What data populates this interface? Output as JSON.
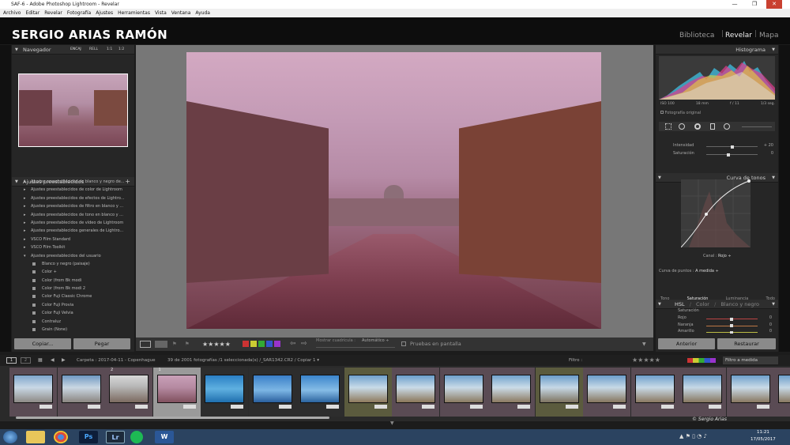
{
  "window": {
    "title": "SAF-6 - Adobe Photoshop Lightroom - Revelar",
    "controls": [
      "—",
      "❐",
      "✕"
    ]
  },
  "menu": [
    "Archivo",
    "Editar",
    "Revelar",
    "Fotografía",
    "Ajustes",
    "Herramientas",
    "Vista",
    "Ventana",
    "Ayuda"
  ],
  "identity": {
    "plate": "SERGIO ARIAS RAMÓN",
    "modules": [
      "Biblioteca",
      "Revelar",
      "Mapa"
    ],
    "active_module": "Revelar"
  },
  "left": {
    "navigator": {
      "title": "Navegador",
      "zoom": [
        "ENCAJ",
        "RELL",
        "1:1",
        "1:2"
      ]
    },
    "presets_title": "Ajustes preestablecidos",
    "presets": [
      "Ajustes preestablecidos de blanco y negro de...",
      "Ajustes preestablecidos de color de Lightroom",
      "Ajustes preestablecidos de efectos de Lightro...",
      "Ajustes preestablecidos de filtro en blanco y ...",
      "Ajustes preestablecidos de tono en blanco y ...",
      "Ajustes preestablecidos de vídeo de Lightroom",
      "Ajustes preestablecidos generales de Lightro...",
      "VSCO Film Standard",
      "VSCO Film Toolkit",
      "Ajustes preestablecidos del usuario"
    ],
    "user_presets": [
      "Blanco y negro (paisaje)",
      "Color +",
      "Color (from Bk modi",
      "Color (from Bk modi 2",
      "Color Fuji Classic Chrome",
      "Color Fuji Provia",
      "Color Fuji Velvia",
      "Contraluz",
      "Grain (None)"
    ],
    "copy_label": "Copiar...",
    "paste_label": "Pegar"
  },
  "right": {
    "histogram_title": "Histograma",
    "exif": [
      "ISO 100",
      "18 mm",
      "f / 11",
      "1/3 seg."
    ],
    "original_label": "Fotografía original",
    "sliders": [
      {
        "label": "Intensidad",
        "value": "+ 20"
      },
      {
        "label": "Saturación",
        "value": "0"
      }
    ],
    "curve_title": "Curva de tonos",
    "curve_channel": "Canal :",
    "curve_channel_value": "Rojo ÷",
    "curve_points_label": "Curva de puntos :",
    "curve_points_value": "A medida ÷",
    "hsl_tabs": [
      "HSL",
      "/",
      "Color",
      "/",
      "Blanco y negro"
    ],
    "hsl_subtabs": [
      "Tono",
      "Saturación",
      "Luminancia",
      "Todo"
    ],
    "hsl_section": "Saturación",
    "hsl_rows": [
      {
        "label": "Rojo",
        "value": "0"
      },
      {
        "label": "Naranja",
        "value": "0"
      },
      {
        "label": "Amarillo",
        "value": "0"
      }
    ],
    "previous_label": "Anterior",
    "reset_label": "Restaurar"
  },
  "toolbar": {
    "stars": "★★★★★",
    "grid_label": "Mostrar cuadrícula :",
    "grid_value": "Automático ÷",
    "softproof_label": "Pruebas en pantalla"
  },
  "filmstrip": {
    "pages": [
      "1",
      "2"
    ],
    "folder": "Carpeta : 2017-04-11 - Copenhague",
    "count": "39 de 2001 fotografías /1 seleccionada(s) /_SAR1342.CR2 / Copiar 1 ▾",
    "filter_label": "Filtro :",
    "filter_value": "Filtro a medida",
    "thumb_labels": [
      "2",
      "1"
    ],
    "thumbs": [
      {
        "bg": "linear-gradient(180deg,#7fa6cc 0%,#c9d8e6 45%,#8d8a85 100%)",
        "frame": "#5a4b54"
      },
      {
        "bg": "linear-gradient(180deg,#6f98c2 0%,#cad7e3 45%,#8a8580 100%)",
        "frame": "#5a4b54"
      },
      {
        "bg": "linear-gradient(180deg,#d7d7d7 0%,#b8b8b8 40%,#7b6a60 100%)",
        "frame": "#5a4b54"
      },
      {
        "bg": "linear-gradient(180deg,#c9a0b8 0%,#b58aa1 45%,#80505e 100%)",
        "frame": "#9a9a9a",
        "selected": true
      },
      {
        "bg": "linear-gradient(180deg,#2a7fc4 0%,#5fb0e0 50%,#1f6fae 100%)",
        "frame": "#2d2d2d"
      },
      {
        "bg": "linear-gradient(180deg,#3a7fc8 0%,#7cb6e4 55%,#2a5f9e 100%)",
        "frame": "#2d2d2d"
      },
      {
        "bg": "linear-gradient(180deg,#3b85cc 0%,#86bde6 55%,#2b639f 100%)",
        "frame": "#2d2d2d"
      },
      {
        "bg": "linear-gradient(180deg,#6fa0cc 0%,#c8dbe8 45%,#8e7a5c 100%)",
        "frame": "#5b5b3e"
      },
      {
        "bg": "linear-gradient(180deg,#6b9ecb 0%,#cadbe8 45%,#8a7658 100%)",
        "frame": "#5a4b54"
      },
      {
        "bg": "linear-gradient(180deg,#6ea0cc 0%,#c9dae7 45%,#8a7a60 100%)",
        "frame": "#5a4b54"
      },
      {
        "bg": "linear-gradient(180deg,#72a3cd 0%,#cbdce8 45%,#8b7960 100%)",
        "frame": "#5a4b54"
      },
      {
        "bg": "linear-gradient(180deg,#6a9cc9 0%,#c6d8e6 45%,#7e7460 100%)",
        "frame": "#5b5b3e"
      },
      {
        "bg": "linear-gradient(180deg,#6c9dca 0%,#c7d9e6 45%,#86765e 100%)",
        "frame": "#5a4b54"
      },
      {
        "bg": "linear-gradient(180deg,#6f9fcb 0%,#c8dae7 45%,#8a7860 100%)",
        "frame": "#5a4b54"
      },
      {
        "bg": "linear-gradient(180deg,#6b9cc9 0%,#c6d8e6 45%,#87775f 100%)",
        "frame": "#5a4b54"
      },
      {
        "bg": "linear-gradient(180deg,#6e9fcb 0%,#c9dae7 45%,#897860 100%)",
        "frame": "#5a4b54"
      },
      {
        "bg": "linear-gradient(180deg,#6d9eca 0%,#c7d9e6 45%,#88775f 100%)",
        "frame": "#5a4b54"
      }
    ]
  },
  "signature": "© Sergio Arias",
  "taskbar": {
    "time": "11:21",
    "date": "17/05/2017",
    "apps": [
      "explorer-icon",
      "chrome-icon",
      "photoshop-icon",
      "lightroom-icon",
      "spotify-icon",
      "word-icon"
    ],
    "app_labels": [
      "Ps",
      "Lr",
      "W"
    ]
  },
  "colors": {
    "accent": "#f5f5f5",
    "panel": "#262626",
    "photo_tint": "#b88aa3"
  }
}
